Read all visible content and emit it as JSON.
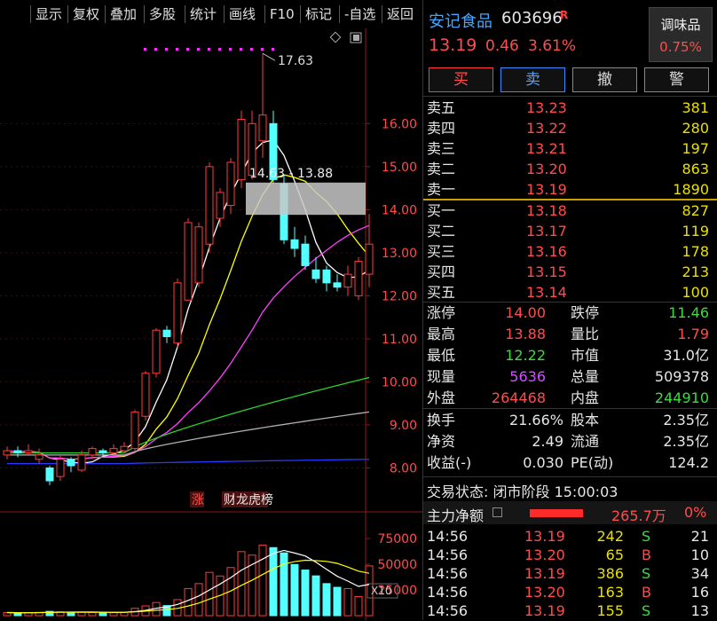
{
  "toolbar": {
    "items": [
      "显示",
      "复权",
      "叠加",
      "多股",
      "统计",
      "画线",
      "F10",
      "标记",
      "-自选",
      "返回"
    ]
  },
  "chart": {
    "price_ticks": [
      "16.00",
      "15.00",
      "14.00",
      "13.00",
      "12.00",
      "11.00",
      "10.00",
      "9.00",
      "8.00"
    ],
    "high_label": "17.63",
    "range_label": "14.63 - 13.88",
    "badges": [
      "涨",
      "财",
      "龙虎榜"
    ],
    "vol_ticks": [
      "75000",
      "50000",
      "25000"
    ],
    "vol_unit": "X10"
  },
  "chart_data": {
    "type": "candlestick",
    "y_range": [
      7.7,
      17.8
    ],
    "candles": [
      [
        8.3,
        8.4,
        8.5,
        8.2
      ],
      [
        8.4,
        8.35,
        8.5,
        8.25
      ],
      [
        8.35,
        8.4,
        8.55,
        8.3
      ],
      [
        8.2,
        8.3,
        8.45,
        8.1
      ],
      [
        8.0,
        7.7,
        8.05,
        7.6
      ],
      [
        7.8,
        8.2,
        8.3,
        7.7
      ],
      [
        8.2,
        8.05,
        8.25,
        7.9
      ],
      [
        7.95,
        8.3,
        8.4,
        7.9
      ],
      [
        8.3,
        8.45,
        8.5,
        8.2
      ],
      [
        8.4,
        8.35,
        8.45,
        8.25
      ],
      [
        8.35,
        8.45,
        8.55,
        8.3
      ],
      [
        8.4,
        8.5,
        8.6,
        8.35
      ],
      [
        8.45,
        9.3,
        9.35,
        8.4
      ],
      [
        9.2,
        10.2,
        10.25,
        9.1
      ],
      [
        10.2,
        11.2,
        11.25,
        10.1
      ],
      [
        11.2,
        11.05,
        11.3,
        10.9
      ],
      [
        10.9,
        12.3,
        12.4,
        10.8
      ],
      [
        11.9,
        13.7,
        13.8,
        11.9
      ],
      [
        12.3,
        13.6,
        13.7,
        12.2
      ],
      [
        13.2,
        15.0,
        15.1,
        13.0
      ],
      [
        13.8,
        14.4,
        14.5,
        13.6
      ],
      [
        14.1,
        15.1,
        15.2,
        13.9
      ],
      [
        14.7,
        16.1,
        16.3,
        14.5
      ],
      [
        14.8,
        16.0,
        16.3,
        14.7
      ],
      [
        15.6,
        16.2,
        17.63,
        15.2
      ],
      [
        16.0,
        14.7,
        16.3,
        14.6
      ],
      [
        14.6,
        13.3,
        14.8,
        13.2
      ],
      [
        13.3,
        13.1,
        13.6,
        12.9
      ],
      [
        13.2,
        12.7,
        13.4,
        12.6
      ],
      [
        12.6,
        12.4,
        12.9,
        12.3
      ],
      [
        12.6,
        12.3,
        12.7,
        12.1
      ],
      [
        12.3,
        12.2,
        12.5,
        12.1
      ],
      [
        12.2,
        12.5,
        12.7,
        12.0
      ],
      [
        12.0,
        12.8,
        12.9,
        11.9
      ],
      [
        12.5,
        13.2,
        13.9,
        12.2
      ]
    ],
    "volumes": [
      3000,
      2800,
      2900,
      3200,
      4200,
      3800,
      3500,
      3300,
      3100,
      3200,
      2900,
      3400,
      7200,
      9500,
      12800,
      9800,
      15600,
      26400,
      31200,
      42100,
      38600,
      46800,
      62300,
      58900,
      68700,
      66200,
      61100,
      49800,
      44400,
      38700,
      31200,
      27600,
      26300,
      18600,
      48400
    ]
  },
  "panel": {
    "name": "安记食品",
    "code": "603696",
    "r_tag": "R",
    "price": "13.19",
    "change": "0.46",
    "change_pct": "3.61%",
    "sector": {
      "name": "调味品",
      "pct": "0.75%"
    },
    "buttons": [
      "买",
      "卖",
      "撤",
      "警"
    ],
    "asks": [
      {
        "label": "卖五",
        "price": "13.23",
        "vol": "381"
      },
      {
        "label": "卖四",
        "price": "13.22",
        "vol": "280"
      },
      {
        "label": "卖三",
        "price": "13.21",
        "vol": "197"
      },
      {
        "label": "卖二",
        "price": "13.20",
        "vol": "863"
      },
      {
        "label": "卖一",
        "price": "13.19",
        "vol": "1890"
      }
    ],
    "bids": [
      {
        "label": "买一",
        "price": "13.18",
        "vol": "827"
      },
      {
        "label": "买二",
        "price": "13.17",
        "vol": "119"
      },
      {
        "label": "买三",
        "price": "13.16",
        "vol": "178"
      },
      {
        "label": "买四",
        "price": "13.15",
        "vol": "213"
      },
      {
        "label": "买五",
        "price": "13.14",
        "vol": "100"
      }
    ],
    "stats": [
      {
        "l1": "涨停",
        "v1": "14.00",
        "c1": "#ff4d4d",
        "l2": "跌停",
        "v2": "11.46",
        "c2": "#3ddc3d"
      },
      {
        "l1": "最高",
        "v1": "13.88",
        "c1": "#ff4d4d",
        "l2": "量比",
        "v2": "1.79",
        "c2": "#ff4d4d"
      },
      {
        "l1": "最低",
        "v1": "12.22",
        "c1": "#3ddc3d",
        "l2": "市值",
        "v2": "31.0亿",
        "c2": "#e6e6e6"
      },
      {
        "l1": "现量",
        "v1": "5636",
        "c1": "#d050ff",
        "l2": "总量",
        "v2": "509378",
        "c2": "#e6e6e6"
      },
      {
        "l1": "外盘",
        "v1": "264468",
        "c1": "#ff4d4d",
        "l2": "内盘",
        "v2": "244910",
        "c2": "#3ddc3d"
      }
    ],
    "stats2": [
      {
        "l1": "换手",
        "v1": "21.66%",
        "l2": "股本",
        "v2": "2.35亿"
      },
      {
        "l1": "净资",
        "v1": "2.49",
        "l2": "流通",
        "v2": "2.35亿"
      },
      {
        "l1": "收益(-)",
        "v1": "0.030",
        "l2": "PE(动)",
        "v2": "124.2"
      }
    ],
    "trade_status": "交易状态: 闭市阶段 15:00:03",
    "fund_flow": {
      "label": "主力净额",
      "value": "265.7万",
      "pct": "0%"
    },
    "ticks": [
      {
        "time": "14:56",
        "price": "13.19",
        "vol": "242",
        "side": "S",
        "n": "21"
      },
      {
        "time": "14:56",
        "price": "13.20",
        "vol": "65",
        "side": "B",
        "n": "10"
      },
      {
        "time": "14:56",
        "price": "13.19",
        "vol": "386",
        "side": "S",
        "n": "34"
      },
      {
        "time": "14:56",
        "price": "13.20",
        "vol": "163",
        "side": "B",
        "n": "16"
      },
      {
        "time": "14:56",
        "price": "13.19",
        "vol": "155",
        "side": "S",
        "n": "13"
      }
    ]
  }
}
